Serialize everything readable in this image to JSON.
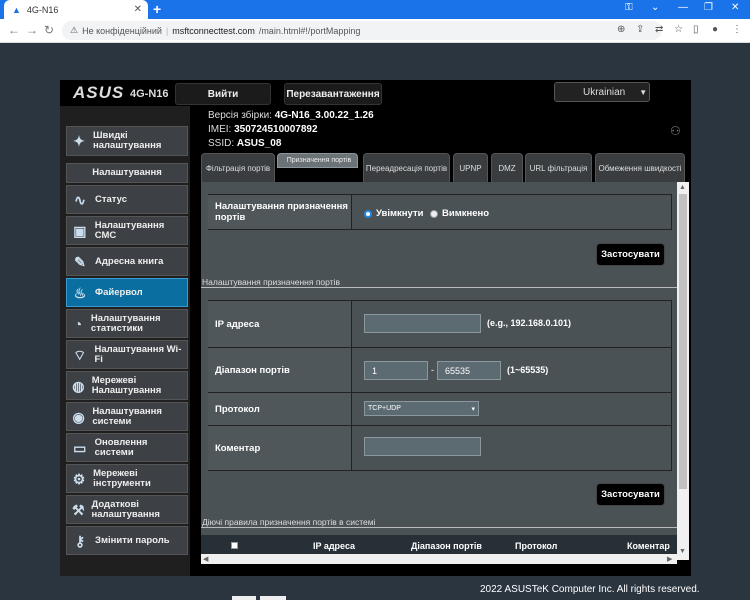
{
  "browser": {
    "tab_title": "4G-N16",
    "url_warning": "Не конфіденційний",
    "url_host": "msftconnecttest.com",
    "url_path": "/main.html#!/portMapping"
  },
  "header": {
    "logo": "ASUS",
    "model": "4G-N16",
    "logout": "Вийти",
    "reboot": "Перезавантаження",
    "language": "Ukrainian"
  },
  "info": {
    "firmware_label": "Версія збірки:",
    "firmware": "4G-N16_3.00.22_1.26",
    "imei_label": "IMEI:",
    "imei": "350724510007892",
    "ssid_label": "SSID:",
    "ssid": "ASUS_08"
  },
  "sidebar": {
    "quick": "Швидкі налаштування",
    "section": "Налаштування",
    "items": [
      "Статус",
      "Налаштування СМС",
      "Адресна книга",
      "Файервол",
      "Налаштування статистики",
      "Налаштування Wi-Fi",
      "Мережеві Налаштування",
      "Налаштування системи",
      "Оновлення системи",
      "Мережеві інструменти",
      "Додаткові налаштування",
      "Змінити пароль"
    ]
  },
  "tabs": [
    "Фільтрація портів",
    "Призначення портів",
    "Переадресація портів",
    "UPNP",
    "DMZ",
    "URL фільтрація",
    "Обмеження швидкості"
  ],
  "form": {
    "enable_label": "Налаштування призначення портів",
    "on": "Увімкнути",
    "off": "Вимкнено",
    "apply": "Застосувати",
    "section_title": "Налаштування призначення портів",
    "ip_label": "IP адреса",
    "ip_value": "",
    "ip_hint": "(e.g., 192.168.0.101)",
    "range_label": "Діапазон портів",
    "range_from": "1",
    "range_sep": "-",
    "range_to": "65535",
    "range_hint": "(1~65535)",
    "protocol_label": "Протокол",
    "protocol": "TCP+UDP",
    "comment_label": "Коментар",
    "comment_value": "",
    "rules_title": "Діючі правила призначення портів в системі"
  },
  "table": {
    "headers": [
      "IP адреса",
      "Діапазон портів",
      "Протокол",
      "Коментар"
    ]
  },
  "footer": "2022 ASUSTeK Computer Inc. All rights reserved."
}
